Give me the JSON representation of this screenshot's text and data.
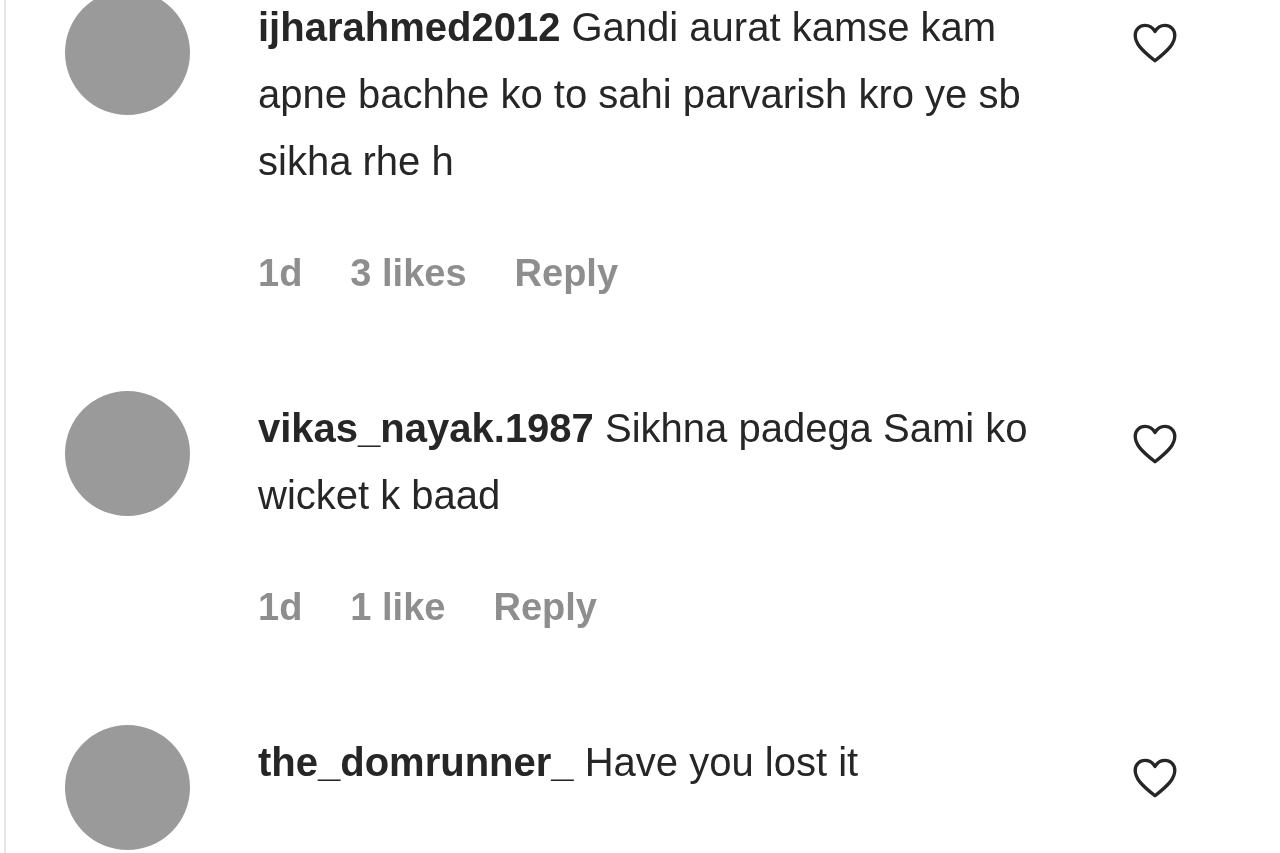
{
  "comments": [
    {
      "username": "ijharahmed2012",
      "text": "Gandi aurat kamse kam apne bachhe ko to sahi parvarish kro ye sb sikha rhe h",
      "time": "1d",
      "likes": "3 likes",
      "reply": "Reply",
      "liked": false
    },
    {
      "username": "vikas_nayak.1987",
      "text": "Sikhna padega Sami ko wicket k baad",
      "time": "1d",
      "likes": "1 like",
      "reply": "Reply",
      "liked": false
    },
    {
      "username": "the_domrunner_",
      "text": "Have you lost it",
      "liked": false
    }
  ]
}
